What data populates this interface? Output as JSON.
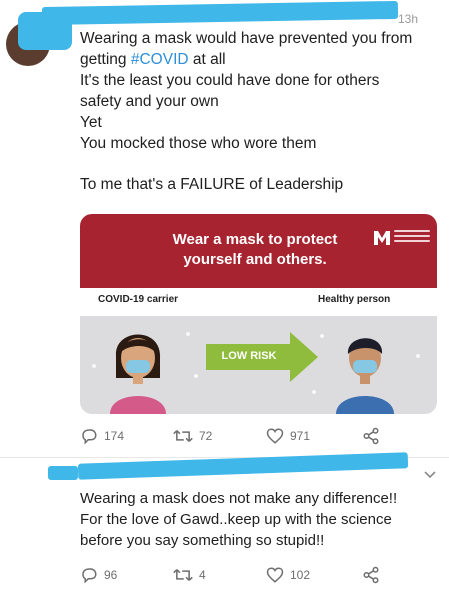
{
  "tweet1": {
    "timestamp": "13h",
    "text_lines": [
      "Wearing a mask would have prevented you from",
      "getting ",
      "It's the least you could have done for others",
      "safety and your own",
      "Yet",
      "You mocked those who wore them",
      "To me that's a FAILURE of Leadership"
    ],
    "hashtag": "#COVID",
    "hashtag_suffix": " at all",
    "card": {
      "headline_line1": "Wear a mask to protect",
      "headline_line2": "yourself and others.",
      "left_label": "COVID-19 carrier",
      "right_label": "Healthy person",
      "arrow_label": "LOW RISK"
    },
    "actions": {
      "reply_count": "174",
      "retweet_count": "72",
      "like_count": "971"
    }
  },
  "tweet2": {
    "text_lines": [
      "Wearing a mask does not make any difference!!",
      "For the love of Gawd..keep up with the science",
      "before you say something so stupid!!"
    ],
    "actions": {
      "reply_count": "96",
      "retweet_count": "4",
      "like_count": "102"
    }
  },
  "colors": {
    "redaction": "#3fb7e8",
    "hashtag": "#2f8fd6",
    "card_header": "#a7232f",
    "arrow": "#8fbc3c"
  },
  "icons": [
    "reply-icon",
    "retweet-icon",
    "like-icon",
    "share-icon",
    "chevron-down-icon"
  ]
}
